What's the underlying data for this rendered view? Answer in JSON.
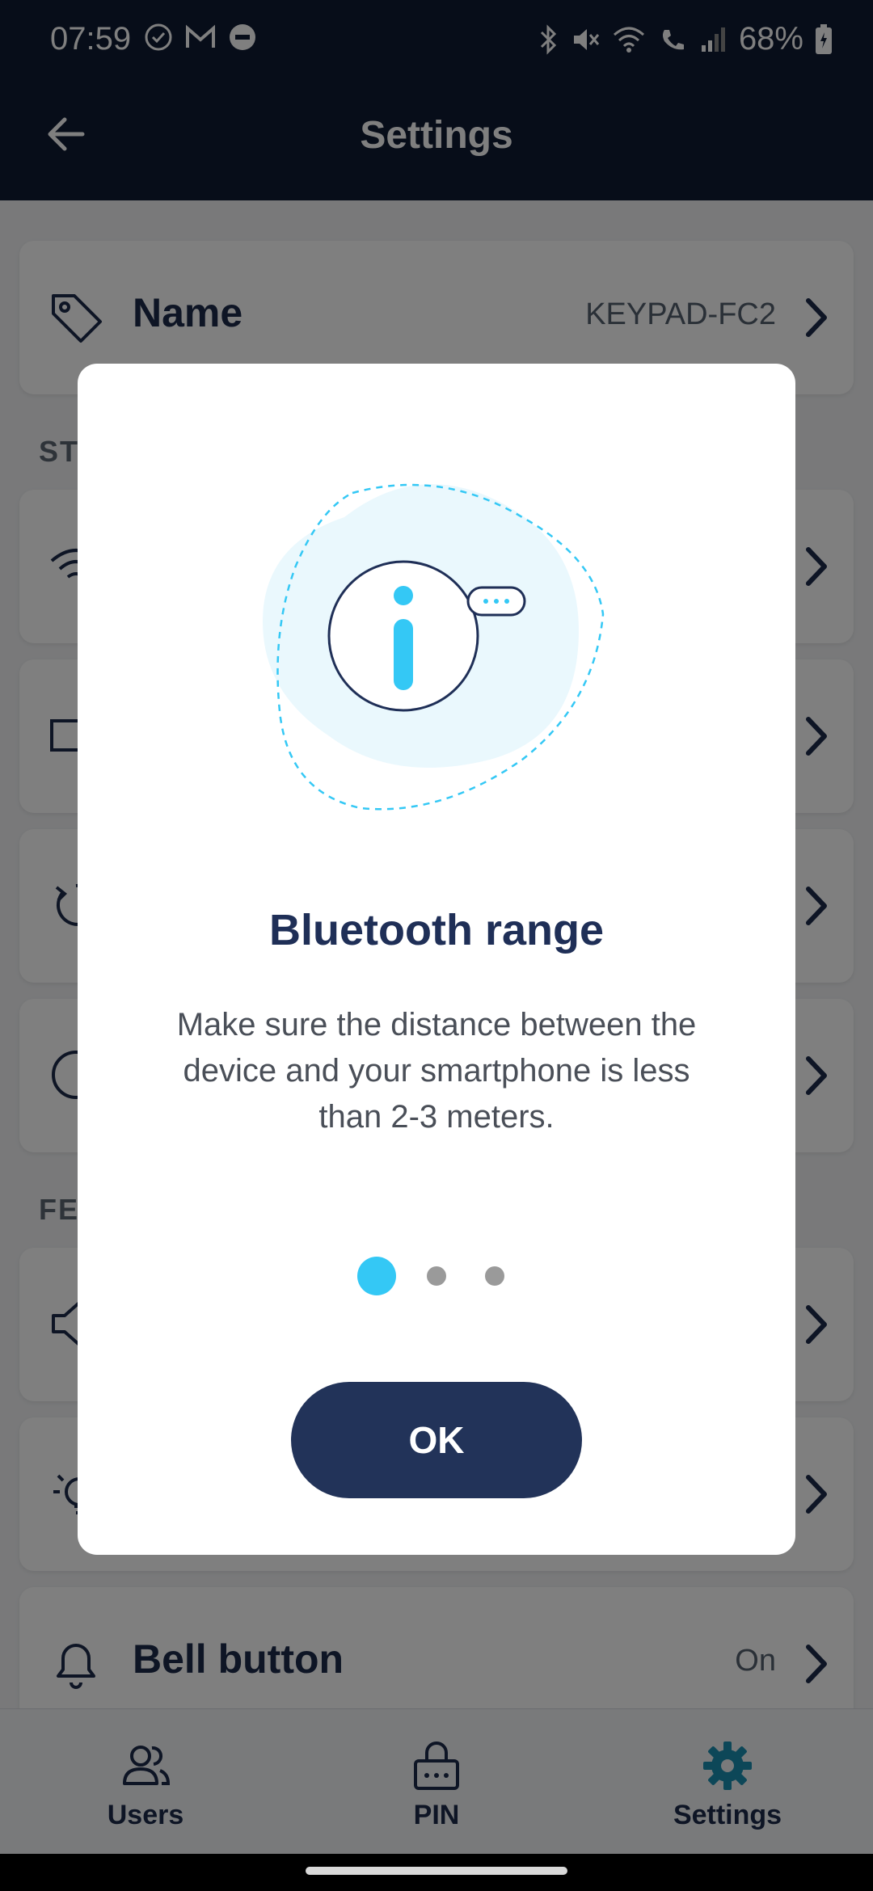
{
  "status_bar": {
    "time": "07:59",
    "battery": "68%",
    "left_icons": [
      "check-circle-icon",
      "gmail-icon",
      "dnd-icon"
    ],
    "right_icons": [
      "bluetooth-icon",
      "mute-icon",
      "wifi-icon",
      "wifi-call-icon",
      "signal-icon",
      "battery-icon"
    ]
  },
  "header": {
    "title": "Settings"
  },
  "settings": {
    "name_row": {
      "label": "Name",
      "value": "KEYPAD-FC2"
    },
    "section_status": "STA",
    "section_features": "FEA",
    "bell_row": {
      "label": "Bell button",
      "value": "On"
    }
  },
  "modal": {
    "title": "Bluetooth range",
    "body": "Make sure the distance between the device and your smartphone is less than 2-3 meters.",
    "ok_label": "OK",
    "page_count": 3,
    "current_page": 1,
    "colors": {
      "accent": "#34c8f5",
      "navy": "#1f2f57",
      "dot_inactive": "#9a9a9a"
    }
  },
  "bottom_nav": {
    "items": [
      {
        "label": "Users",
        "icon": "users-icon",
        "active": false
      },
      {
        "label": "PIN",
        "icon": "keypad-lock-icon",
        "active": false
      },
      {
        "label": "Settings",
        "icon": "gear-icon",
        "active": true
      }
    ]
  },
  "colors": {
    "header_bg": "#0f1a33",
    "active_icon": "#1a8fb0"
  }
}
